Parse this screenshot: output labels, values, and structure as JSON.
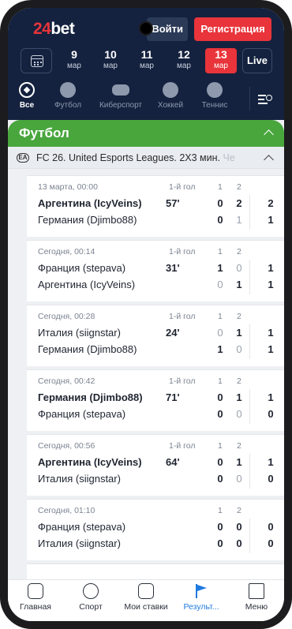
{
  "header": {
    "logo_num": "24",
    "logo_text": "bet",
    "login_label": "Войти",
    "register_label": "Регистрация"
  },
  "dates": [
    {
      "day": "9",
      "month": "мар"
    },
    {
      "day": "10",
      "month": "мар"
    },
    {
      "day": "11",
      "month": "мар"
    },
    {
      "day": "12",
      "month": "мар"
    },
    {
      "day": "13",
      "month": "мар"
    }
  ],
  "live_label": "Live",
  "sports": [
    {
      "label": "Все"
    },
    {
      "label": "Футбол"
    },
    {
      "label": "Киберспорт"
    },
    {
      "label": "Хоккей"
    },
    {
      "label": "Теннис"
    }
  ],
  "section": {
    "title": "Футбол"
  },
  "league": {
    "name": "FC 26. United Esports Leagues. 2X3 мин.",
    "name_fade": "Че"
  },
  "col1": "1",
  "col2": "2",
  "matches": [
    {
      "time": "13 марта, 00:00",
      "event": "1-й гол",
      "team1": "Аргентина (IcyVeins)",
      "team2": "Германия (Djimbo88)",
      "minute": "57'",
      "s1": [
        "0",
        "0"
      ],
      "s2": [
        "2",
        "1"
      ],
      "total": [
        "2",
        "1"
      ]
    },
    {
      "time": "Сегодня, 00:14",
      "event": "1-й гол",
      "team1": "Франция (stepava)",
      "team2": "Аргентина (IcyVeins)",
      "minute": "31'",
      "s1": [
        "1",
        "0"
      ],
      "s2": [
        "0",
        "1"
      ],
      "total": [
        "1",
        "1"
      ]
    },
    {
      "time": "Сегодня, 00:28",
      "event": "1-й гол",
      "team1": "Италия (siignstar)",
      "team2": "Германия (Djimbo88)",
      "minute": "24'",
      "s1": [
        "0",
        "1"
      ],
      "s2": [
        "1",
        "0"
      ],
      "total": [
        "1",
        "1"
      ]
    },
    {
      "time": "Сегодня, 00:42",
      "event": "1-й гол",
      "team1": "Германия (Djimbo88)",
      "team2": "Франция (stepava)",
      "minute": "71'",
      "s1": [
        "0",
        "0"
      ],
      "s2": [
        "1",
        "0"
      ],
      "total": [
        "1",
        "0"
      ]
    },
    {
      "time": "Сегодня, 00:56",
      "event": "1-й гол",
      "team1": "Аргентина (IcyVeins)",
      "team2": "Италия (siignstar)",
      "minute": "64'",
      "s1": [
        "0",
        "0"
      ],
      "s2": [
        "1",
        "0"
      ],
      "total": [
        "1",
        "0"
      ]
    },
    {
      "time": "Сегодня, 01:10",
      "event": "",
      "team1": "Франция (stepava)",
      "team2": "Италия (siignstar)",
      "minute": "",
      "s1": [
        "0",
        "0"
      ],
      "s2": [
        "0",
        "0"
      ],
      "total": [
        "0",
        "0"
      ]
    }
  ],
  "nav": [
    {
      "label": "Главная"
    },
    {
      "label": "Спорт"
    },
    {
      "label": "Мои ставки"
    },
    {
      "label": "Результ..."
    },
    {
      "label": "Меню"
    }
  ]
}
